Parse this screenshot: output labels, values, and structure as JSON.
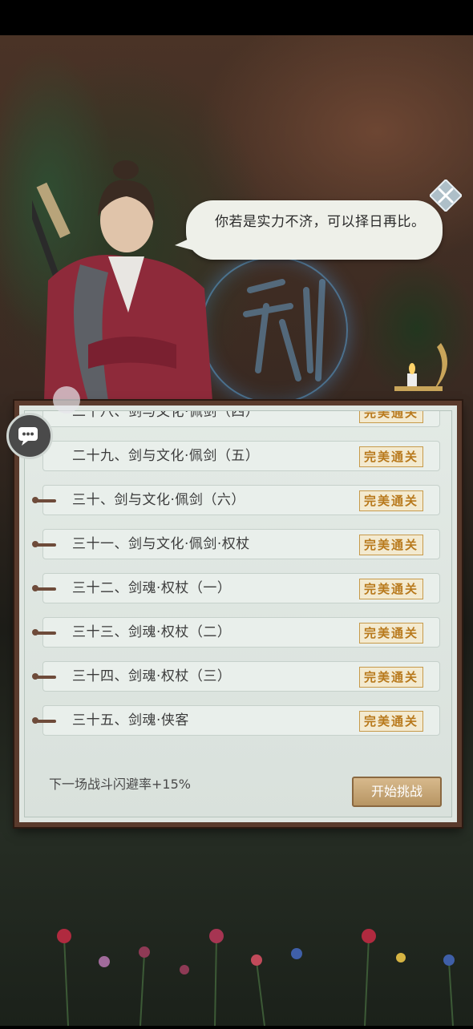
{
  "dialog": {
    "text": "你若是实力不济，可以择日再比。"
  },
  "challenge_list": {
    "partial_top_label": "二十八、剑与文化·佩剑（四）",
    "items": [
      {
        "label": "二十九、剑与文化·佩剑（五）",
        "status": "完美通关"
      },
      {
        "label": "三十、剑与文化·佩剑（六）",
        "status": "完美通关"
      },
      {
        "label": "三十一、剑与文化·佩剑·权杖",
        "status": "完美通关"
      },
      {
        "label": "三十二、剑魂·权杖（一）",
        "status": "完美通关"
      },
      {
        "label": "三十三、剑魂·权杖（二）",
        "status": "完美通关"
      },
      {
        "label": "三十四、剑魂·权杖（三）",
        "status": "完美通关"
      },
      {
        "label": "三十五、剑魂·侠客",
        "status": "完美通关"
      }
    ],
    "partial_top_status": "完美通关"
  },
  "footer": {
    "bonus_text": "下一场战斗闪避率+15%",
    "start_button": "开始挑战"
  },
  "icons": {
    "close": "close-icon",
    "chat": "chat-icon"
  },
  "colors": {
    "panel_frame": "#5a3a2c",
    "badge_gold": "#b8791c",
    "button_gold": "#c8a674"
  }
}
